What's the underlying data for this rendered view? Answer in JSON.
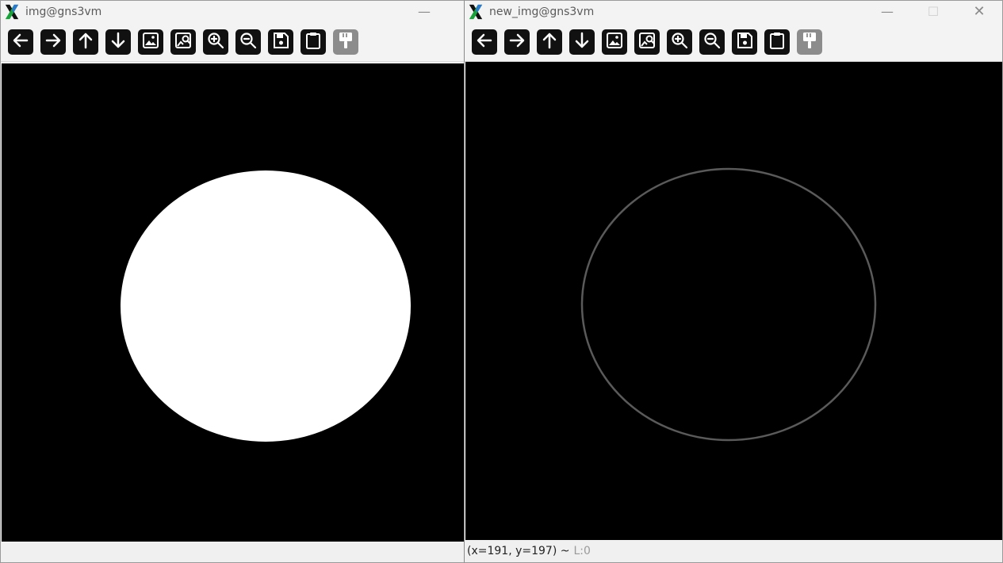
{
  "window_left": {
    "title": "img@gns3vm",
    "toolbar": [
      {
        "name": "back",
        "icon": "arrow-left-icon"
      },
      {
        "name": "forward",
        "icon": "arrow-right-icon"
      },
      {
        "name": "up",
        "icon": "arrow-up-icon"
      },
      {
        "name": "down",
        "icon": "arrow-down-icon"
      },
      {
        "name": "fit-image",
        "icon": "image-icon"
      },
      {
        "name": "zoom-to-image",
        "icon": "image-search-icon"
      },
      {
        "name": "zoom-in",
        "icon": "zoom-in-icon"
      },
      {
        "name": "zoom-out",
        "icon": "zoom-out-icon"
      },
      {
        "name": "save",
        "icon": "save-icon"
      },
      {
        "name": "copy",
        "icon": "clipboard-icon"
      },
      {
        "name": "properties",
        "icon": "paint-brush-icon"
      }
    ],
    "minimize": "—"
  },
  "window_right": {
    "title": "new_img@gns3vm",
    "minimize": "—",
    "maximize": "☐",
    "close": "✕",
    "status_coords": "(x=191, y=197) ~",
    "status_level": "L:0"
  },
  "colors": {
    "canvas": "#000000",
    "filled_circle": "#ffffff",
    "edge_ring": "#5a5a5a",
    "titlebar": "#f3f3f3",
    "button": "#111111"
  }
}
